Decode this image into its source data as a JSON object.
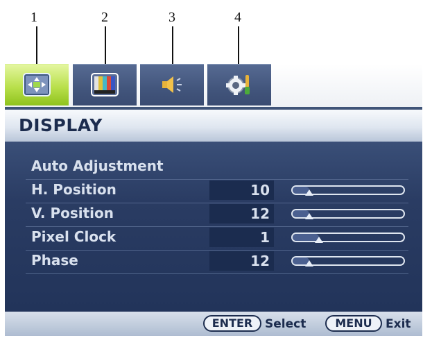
{
  "callouts": [
    "1",
    "2",
    "3",
    "4"
  ],
  "tabs": [
    {
      "icon": "display-adjust-icon",
      "active": true
    },
    {
      "icon": "picture-color-bars-icon",
      "active": false
    },
    {
      "icon": "speaker-icon",
      "active": false
    },
    {
      "icon": "system-gear-icon",
      "active": false
    }
  ],
  "header": {
    "title": "DISPLAY"
  },
  "menu": {
    "items": [
      {
        "label": "Auto Adjustment"
      },
      {
        "label": "H. Position",
        "value": "10",
        "level_percent": 15
      },
      {
        "label": "V. Position",
        "value": "12",
        "level_percent": 15
      },
      {
        "label": "Pixel Clock",
        "value": "1",
        "level_percent": 24
      },
      {
        "label": "Phase",
        "value": "12",
        "level_percent": 15
      }
    ]
  },
  "footer": {
    "enter_key": "ENTER",
    "enter_action": "Select",
    "menu_key": "MENU",
    "menu_action": "Exit"
  },
  "colors": {
    "panel": "#1f3359",
    "active_tab": "#b9e04c",
    "inactive_tab": "#42557c",
    "text": "#d9e1ee",
    "header_text": "#1c2c4e"
  }
}
